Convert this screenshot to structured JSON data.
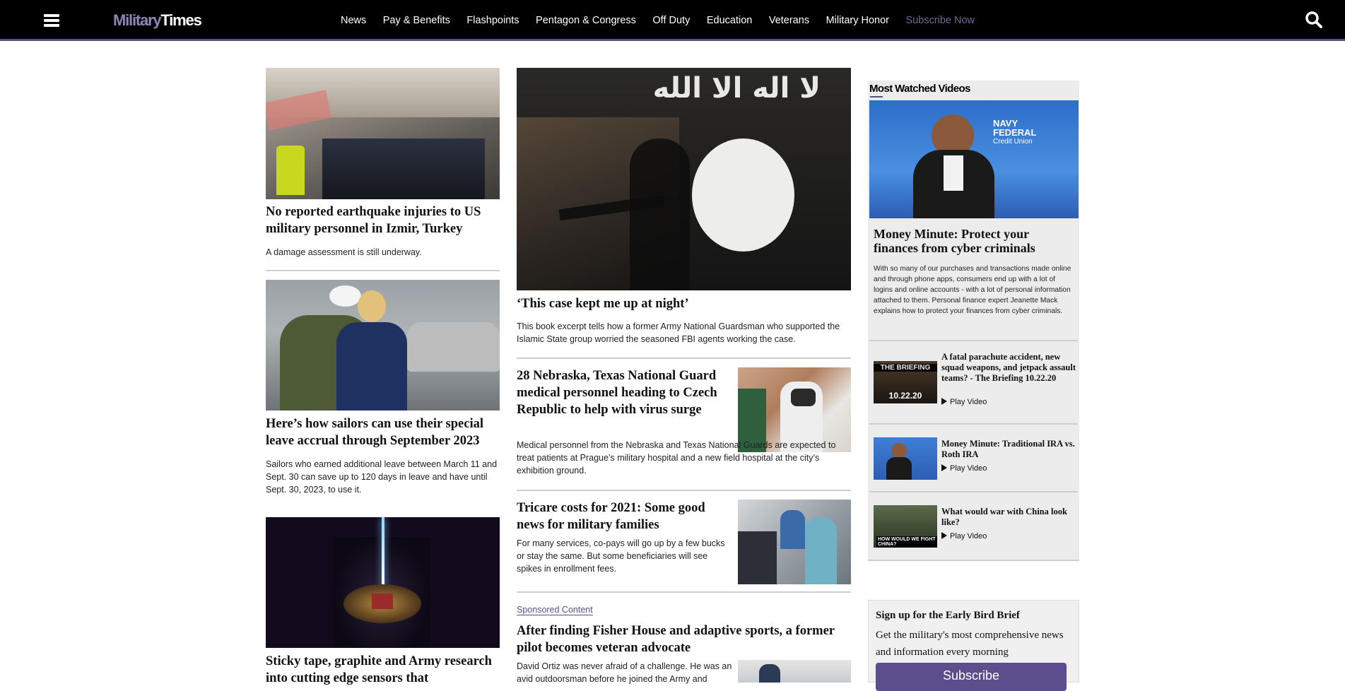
{
  "header": {
    "logo_part1": "Military",
    "logo_part2": "Times",
    "nav": [
      "News",
      "Pay & Benefits",
      "Flashpoints",
      "Pentagon & Congress",
      "Off Duty",
      "Education",
      "Veterans",
      "Military Honor",
      "Subscribe Now"
    ]
  },
  "left": {
    "story1": {
      "headline": "No reported earthquake injuries to US military personnel in Izmir, Turkey",
      "summary": "A damage assessment is still underway."
    },
    "story2": {
      "headline": "Here’s how sailors can use their special leave accrual through September 2023",
      "summary": "Sailors who earned additional leave between March 11 and Sept. 30 can save up to 120 days in leave and have until Sept. 30, 2023, to use it."
    },
    "story3": {
      "headline": "Sticky tape, graphite and Army research into cutting edge sensors that"
    }
  },
  "center": {
    "lead": {
      "flag_text": "لا اله الا الله",
      "headline": "‘This case kept me up at night’",
      "summary": "This book excerpt tells how a former Army National Guardsman who supported the Islamic State group worried the seasoned FBI agents working the case."
    },
    "story2": {
      "headline": "28 Nebraska, Texas National Guard medical personnel heading to Czech Republic to help with virus surge",
      "summary": "Medical personnel from the Nebraska and Texas National Guards are expected to treat patients at Prague’s military hospital and a new field hospital at the city’s exhibition ground."
    },
    "story3": {
      "headline": "Tricare costs for 2021: Some good news for military families",
      "summary": "For many services, co-pays will go up by a few bucks or stay the same. But some beneficiaries will see spikes in enrollment fees."
    },
    "sponsored": {
      "label": "Sponsored Content",
      "headline": "After finding Fisher House and adaptive sports, a former pilot becomes veteran advocate",
      "summary": "David Ortiz was never afraid of a challenge. He was an avid outdoorsman before he joined the Army and"
    }
  },
  "sidebar": {
    "title": "Most Watched Videos",
    "feature": {
      "brand_line1": "NAVY",
      "brand_line2": "FEDERAL",
      "brand_line3": "Credit Union",
      "headline": "Money Minute: Protect your finances from cyber criminals",
      "summary": "With so many of our purchases and transactions made online and through phone apps, consumers end up with a lot of logins and online accounts - with a lot of personal information attached to them. Personal finance expert Jeanette Mack explains how to protect your finances from cyber criminals."
    },
    "videos": [
      {
        "headline": "A fatal parachute accident, new squad weapons, and jetpack assault teams? - The Briefing 10.22.20",
        "play": "Play Video",
        "thumb_top": "THE BRIEFING",
        "thumb_bottom": "10.22.20"
      },
      {
        "headline": "Money Minute: Traditional IRA vs. Roth IRA",
        "play": "Play Video"
      },
      {
        "headline": "What would war with China look like?",
        "play": "Play Video",
        "thumb_caption": "HOW WOULD WE FIGHT CHINA?"
      }
    ]
  },
  "signup": {
    "title": "Sign up for the Early Bird Brief",
    "text": "Get the military's most comprehensive news and information every morning",
    "button": "Subscribe"
  }
}
